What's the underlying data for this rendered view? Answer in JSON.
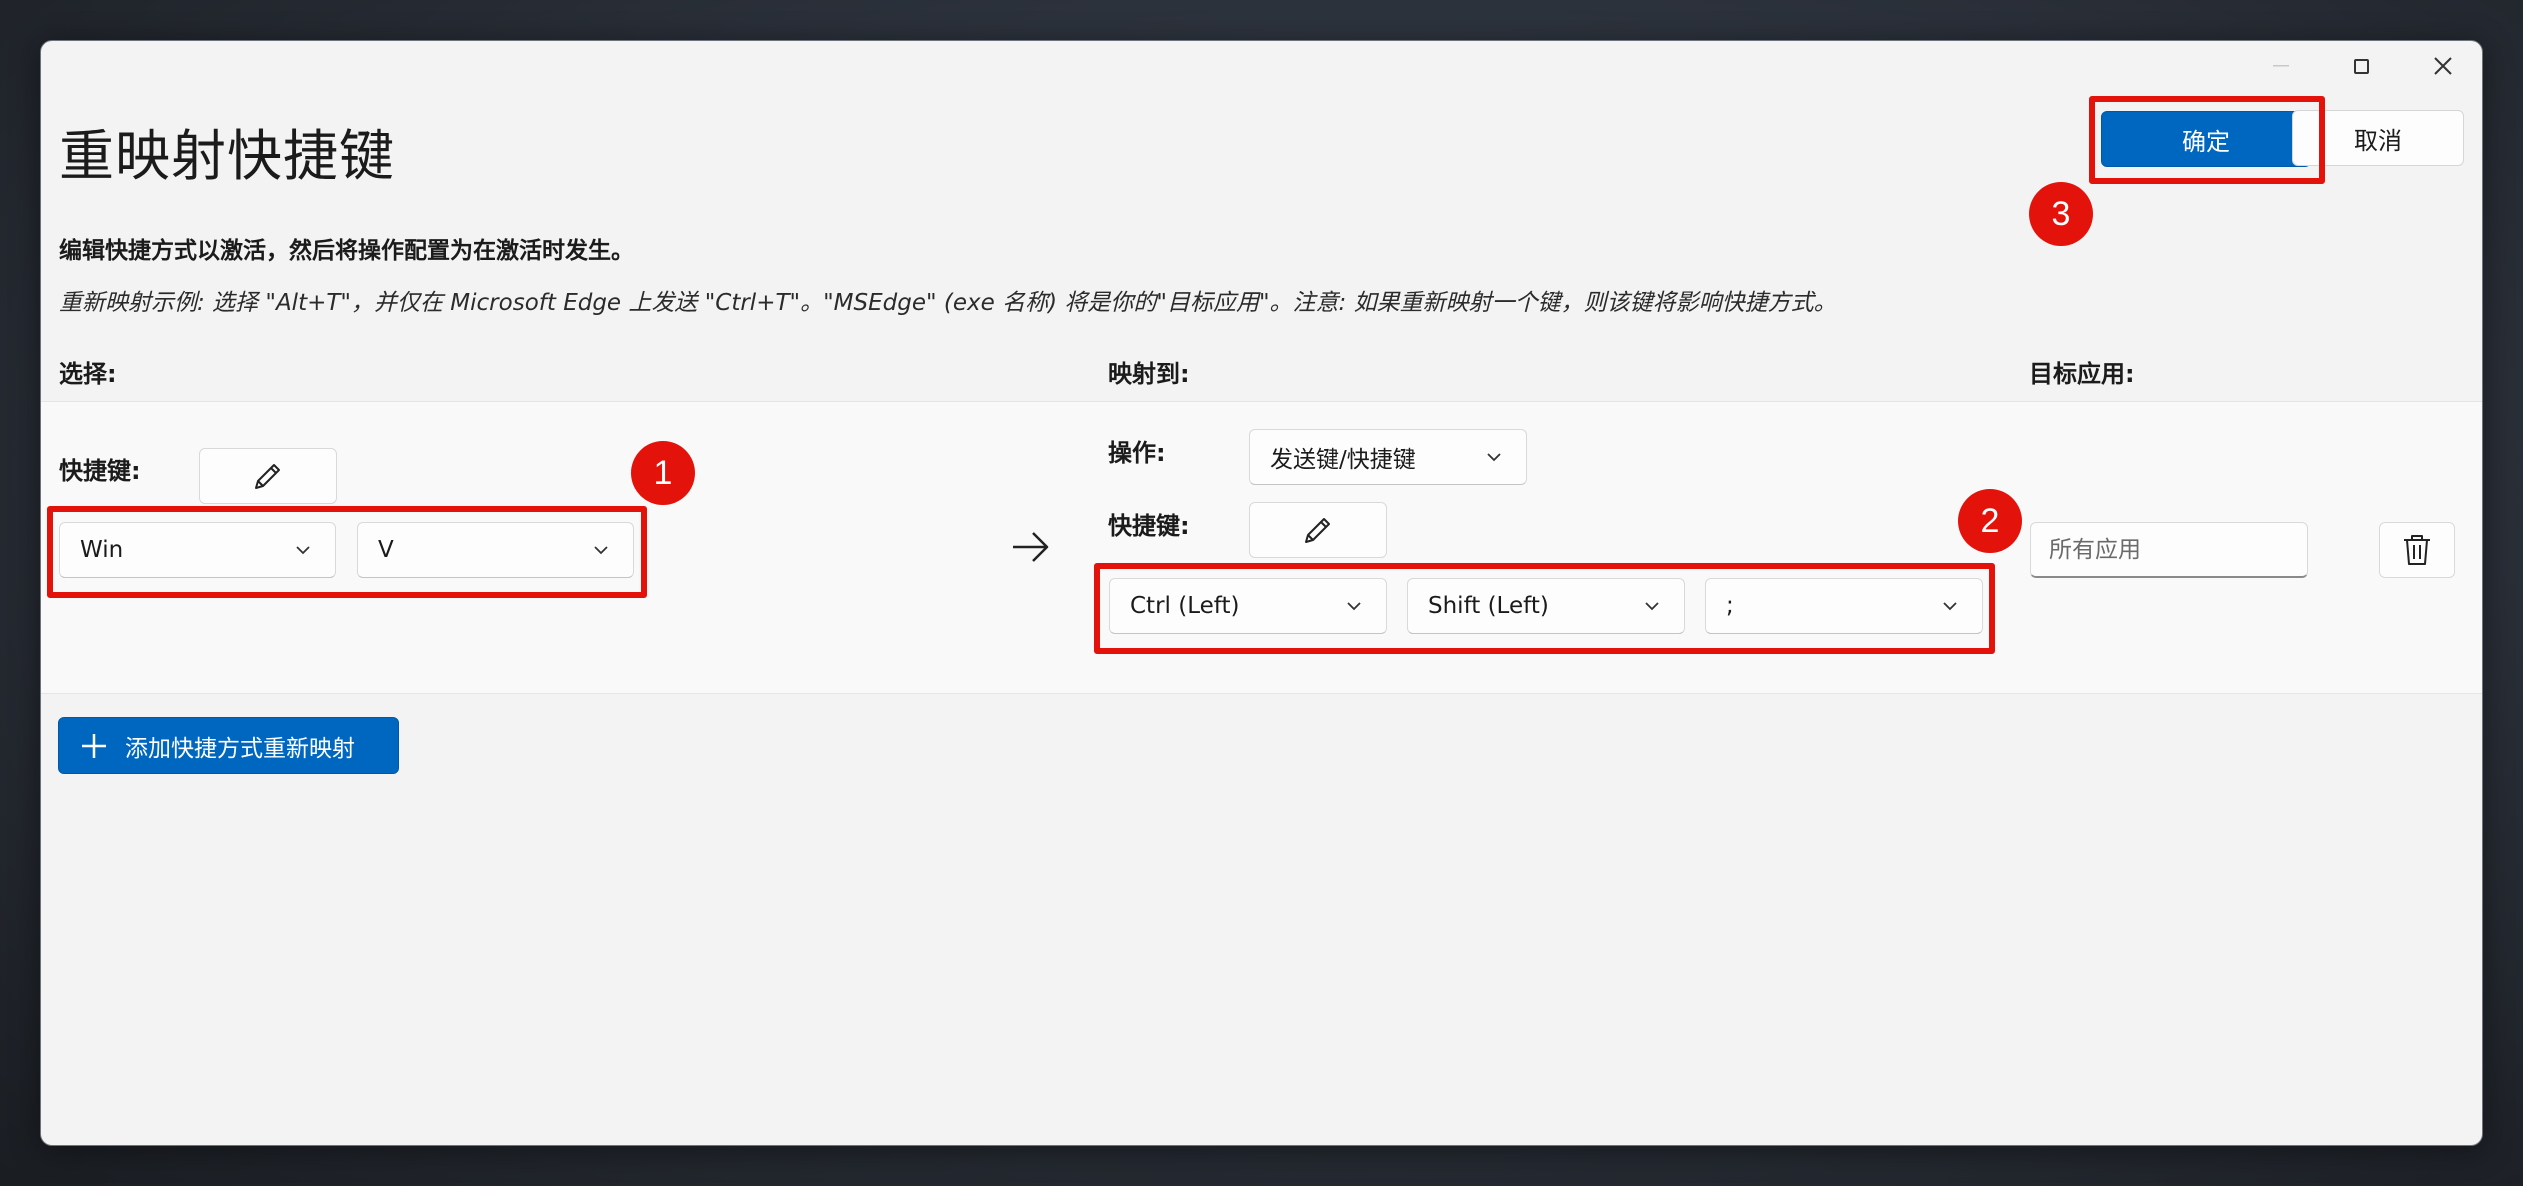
{
  "window": {
    "title": "重映射快捷键",
    "ok_label": "确定",
    "cancel_label": "取消"
  },
  "description": {
    "bold": "编辑快捷方式以激活，然后将操作配置为在激活时发生。",
    "example": "重新映射示例: 选择 \"Alt+T\"，并仅在 Microsoft Edge 上发送 \"Ctrl+T\"。\"MSEdge\" (exe 名称) 将是你的\"目标应用\"。注意: 如果重新映射一个键，则该键将影响快捷方式。"
  },
  "columns": {
    "select": "选择:",
    "map_to": "映射到:",
    "target_app": "目标应用:"
  },
  "row": {
    "select": {
      "shortcut_label": "快捷键:",
      "keys": [
        "Win",
        "V"
      ]
    },
    "map_to": {
      "action_label": "操作:",
      "action_value": "发送键/快捷键",
      "shortcut_label": "快捷键:",
      "keys": [
        "Ctrl (Left)",
        "Shift (Left)",
        ";"
      ]
    },
    "target_app": {
      "placeholder": "所有应用"
    }
  },
  "add_button_label": "添加快捷方式重新映射",
  "annotations": [
    "1",
    "2",
    "3"
  ],
  "colors": {
    "accent": "#0067c0",
    "annotation_red": "#e3120b"
  }
}
